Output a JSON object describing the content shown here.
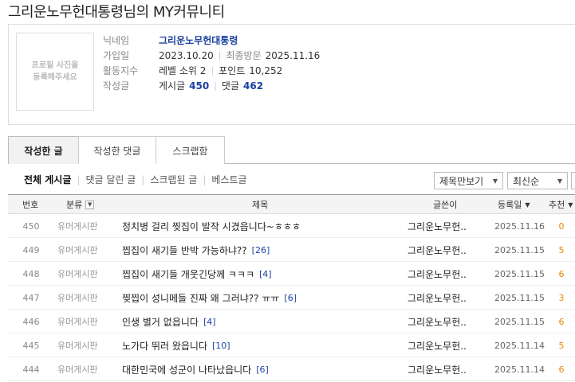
{
  "page": {
    "title": "그리운노무헌대통령님의 MY커뮤니티"
  },
  "profile": {
    "avatar_placeholder": "프로필 사진을\n등록해주세요",
    "nickname_label": "닉네임",
    "nickname": "그리운노무헌대통령",
    "joined_label": "가입일",
    "joined": "2023.10.20",
    "last_visit_label": "최종방문",
    "last_visit": "2025.11.16",
    "activity_label": "활동지수",
    "level": "레벨 소위 2",
    "points_label": "포인트",
    "points": "10,252",
    "written_label": "작성글",
    "posts_label": "게시글",
    "posts_count": "450",
    "comments_label": "댓글",
    "comments_count": "462"
  },
  "tabs": [
    {
      "label": "작성한 글",
      "active": true
    },
    {
      "label": "작성한 댓글",
      "active": false
    },
    {
      "label": "스크랩함",
      "active": false
    }
  ],
  "subnav": [
    "전체 게시글",
    "댓글 달린 글",
    "스크랩된 글",
    "베스트글"
  ],
  "filters": {
    "view_select": "제목만보기",
    "sort_select": "최신순"
  },
  "table": {
    "headers": {
      "num": "번호",
      "category": "분류",
      "title": "제목",
      "author": "글쓴이",
      "date": "등록일",
      "rec": "추천"
    },
    "rows": [
      {
        "num": "450",
        "category": "유머게시판",
        "title": "정치병 걸리 찢집이 발작 시겼읍니다~ㅎㅎㅎ",
        "comments": "",
        "author": "그리운노무헌..",
        "date": "2025.11.16",
        "rec": "0"
      },
      {
        "num": "449",
        "category": "유머게시판",
        "title": "찝집이 새기들 반박 가능하냐??",
        "comments": "[26]",
        "author": "그리운노무헌..",
        "date": "2025.11.15",
        "rec": "5"
      },
      {
        "num": "448",
        "category": "유머게시판",
        "title": "찝집이 새기들 개웃긴당께 ㅋㅋㅋ",
        "comments": "[4]",
        "author": "그리운노무헌..",
        "date": "2025.11.15",
        "rec": "6"
      },
      {
        "num": "447",
        "category": "유머게시판",
        "title": "찢찝이 성니메들 진짜 왜 그러냐?? ㅠㅠ",
        "comments": "[6]",
        "author": "그리운노무헌..",
        "date": "2025.11.15",
        "rec": "3"
      },
      {
        "num": "446",
        "category": "유머게시판",
        "title": "인생 별거 없읍니다",
        "comments": "[4]",
        "author": "그리운노무헌..",
        "date": "2025.11.15",
        "rec": "6"
      },
      {
        "num": "445",
        "category": "유머게시판",
        "title": "노가다 뛰러 왔읍니다",
        "comments": "[10]",
        "author": "그리운노무헌..",
        "date": "2025.11.14",
        "rec": "5"
      },
      {
        "num": "444",
        "category": "유머게시판",
        "title": "대한민국에 성군이 나타났읍니다",
        "comments": "[6]",
        "author": "그리운노무헌..",
        "date": "2025.11.14",
        "rec": "6"
      }
    ]
  }
}
